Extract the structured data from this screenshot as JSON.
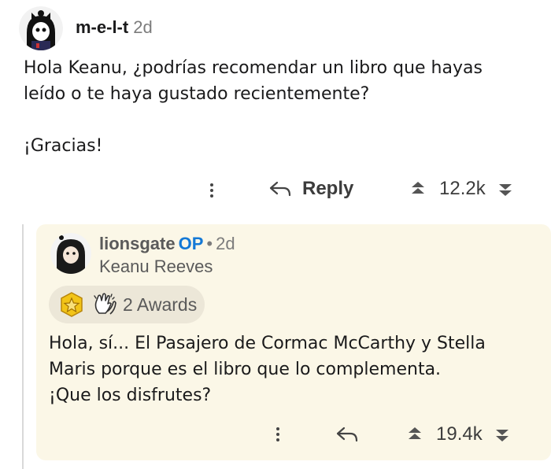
{
  "comment": {
    "username": "m-e-l-t",
    "time": "2d",
    "lines": [
      "Hola Keanu, ¿podrías recomendar un libro que hayas",
      "leído o te haya gustado recientemente?"
    ],
    "closing": "¡Gracias!",
    "reply_label": "Reply",
    "score": "12.2k"
  },
  "reply": {
    "username": "lionsgate",
    "op_badge": "OP",
    "separator": "•",
    "time": "2d",
    "flair": "Keanu Reeves",
    "awards_label": "2 Awards",
    "lines": [
      "Hola, sí... El Pasajero de Cormac McCarthy y Stella",
      "Maris porque es el libro que lo complementa.",
      "¡Que los disfrutes?"
    ],
    "score": "19.4k"
  },
  "colors": {
    "reply_bg": "#fbf7e7",
    "op_blue": "#1479d6",
    "award_pill": "#ece7d8"
  },
  "icons": [
    "more-options-icon",
    "reply-arrow-icon",
    "upvote-icon",
    "downvote-icon",
    "gold-award-icon",
    "clapping-hands-award-icon"
  ]
}
